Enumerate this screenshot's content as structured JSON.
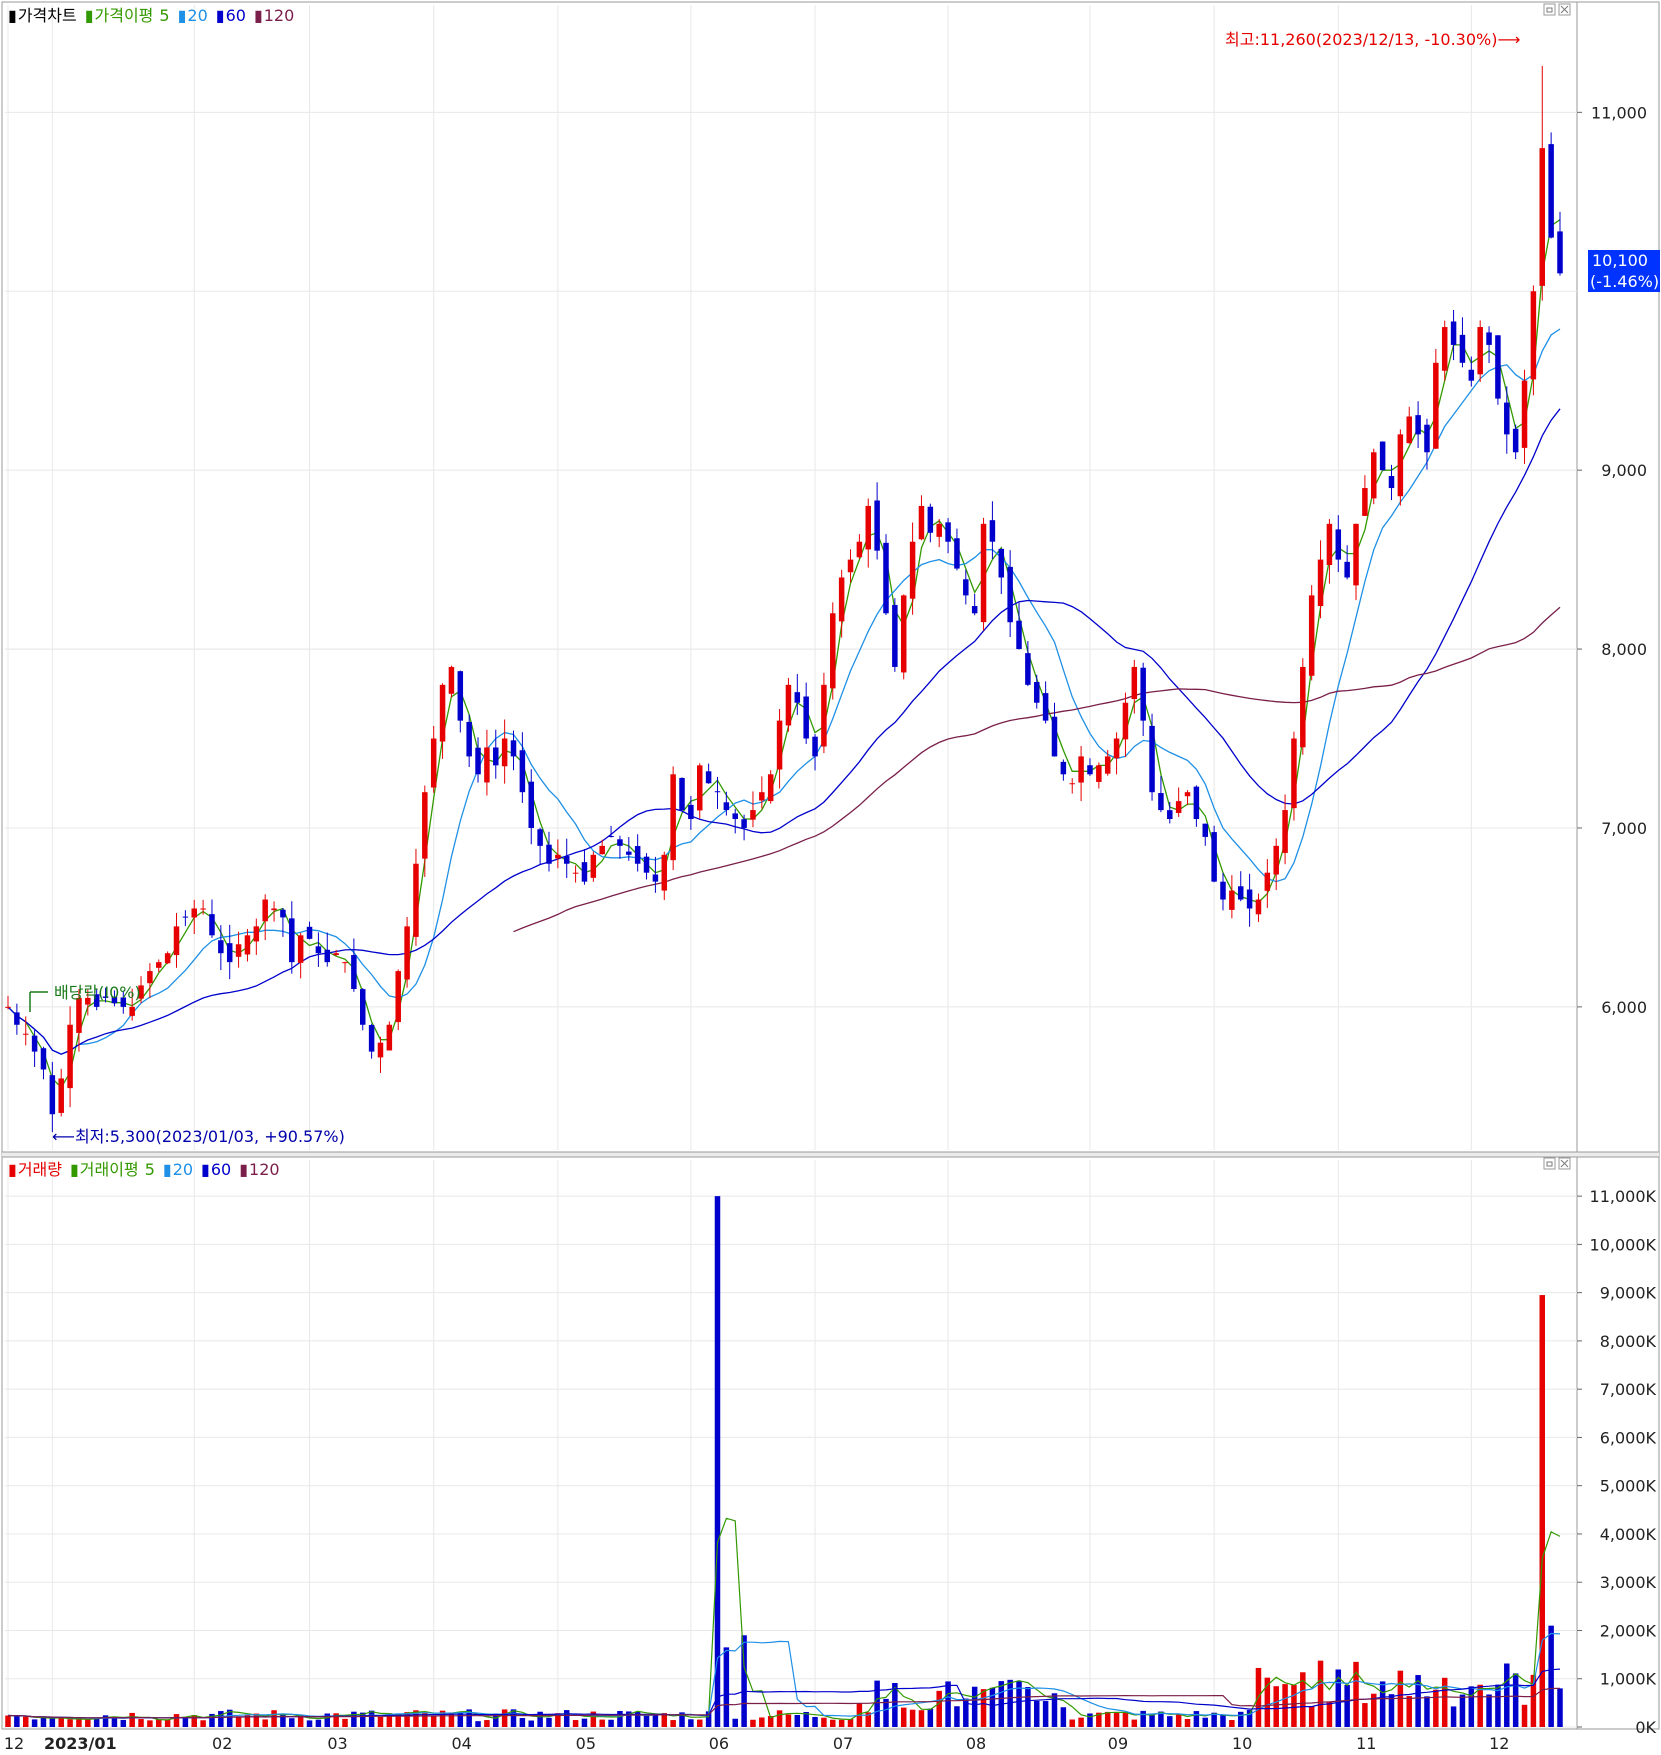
{
  "price_panel": {
    "legend": [
      {
        "label": "가격차트",
        "color": "#000000"
      },
      {
        "label": "가격이평",
        "color": "#339900"
      },
      {
        "label": "5",
        "color": "#339900"
      },
      {
        "label": "20",
        "color": "#1e90e6"
      },
      {
        "label": "60",
        "color": "#0000cc"
      },
      {
        "label": "120",
        "color": "#7a1f4a"
      }
    ],
    "max_annotation": "최고:11,260(2023/12/13, -10.30%)⟶",
    "min_annotation": "⟵최저:5,300(2023/01/03, +90.57%)",
    "dividend_marker": "배당락(I0%)",
    "current_price": "10,100",
    "current_change": "(-1.46%)"
  },
  "volume_panel": {
    "legend": [
      {
        "label": "거래량",
        "color": "#e60000"
      },
      {
        "label": "거래이평",
        "color": "#339900"
      },
      {
        "label": "5",
        "color": "#339900"
      },
      {
        "label": "20",
        "color": "#1e90e6"
      },
      {
        "label": "60",
        "color": "#0000cc"
      },
      {
        "label": "120",
        "color": "#7a1f4a"
      }
    ]
  },
  "chart_data": [
    {
      "type": "candlestick",
      "title": "가격차트",
      "y_ticks": [
        "11,000",
        "9,000",
        "8,000",
        "7,000",
        "6,000"
      ],
      "ylim": [
        5200,
        11600
      ],
      "x_ticks": [
        "12",
        "2023/01",
        "02",
        "03",
        "04",
        "05",
        "06",
        "07",
        "08",
        "09",
        "10",
        "11",
        "12"
      ],
      "grid": true,
      "anchors": {
        "high": 11260,
        "high_date": "2023/12/13",
        "low": 5300,
        "low_date": "2023/01/03",
        "last_close": 10100
      },
      "trend": [
        6000,
        5900,
        5850,
        5750,
        5650,
        5400,
        5600,
        5900,
        6050,
        6050,
        6000,
        6050,
        6020,
        6000,
        6000,
        6120,
        6200,
        6250,
        6300,
        6450,
        6500,
        6550,
        6550,
        6400,
        6300,
        6250,
        6350,
        6400,
        6450,
        6600,
        6550,
        6500,
        6250,
        6400,
        6380,
        6300,
        6250,
        6300,
        6250,
        6100,
        5900,
        5750,
        5800,
        5900,
        6200,
        6450,
        6800,
        7200,
        7500,
        7800,
        7900,
        7600,
        7400,
        7300,
        7450,
        7350,
        7500,
        7400,
        7200,
        7000,
        6900,
        6800,
        6850,
        6800,
        6750,
        6700,
        6850,
        6900,
        6950,
        6900,
        6850,
        6800,
        6750,
        6700,
        6850,
        7300,
        7100,
        7050,
        7350,
        7250,
        7200,
        7100,
        7050,
        7000,
        7100,
        7200,
        7300,
        7600,
        7800,
        7700,
        7500,
        7400,
        7800,
        8200,
        8400,
        8500,
        8600,
        8800,
        8550,
        8200,
        7900,
        8300,
        8600,
        8800,
        8650,
        8700,
        8600,
        8450,
        8300,
        8200,
        8700,
        8600,
        8400,
        8150,
        8000,
        7800,
        7700,
        7600,
        7400,
        7300,
        7250,
        7400,
        7300,
        7350,
        7400,
        7500,
        7700,
        7900,
        7600,
        7200,
        7100,
        7050,
        7150,
        7200,
        7050,
        6950,
        6700,
        6600,
        6650,
        6600,
        6550,
        6600,
        6750,
        6900,
        7100,
        7500,
        7900,
        8300,
        8500,
        8700,
        8500,
        8400,
        8700,
        8900,
        9100,
        9000,
        8900,
        9200,
        9300,
        9200,
        9100,
        9600,
        9800,
        9700,
        9600,
        9500,
        9800,
        9700,
        9400,
        9200,
        9100,
        9500,
        10000,
        10800,
        10300,
        10100
      ],
      "ma_periods": [
        5,
        20,
        60,
        120
      ]
    },
    {
      "type": "bar",
      "title": "거래량",
      "y_ticks": [
        "11,000K",
        "10,000K",
        "9,000K",
        "8,000K",
        "7,000K",
        "6,000K",
        "5,000K",
        "4,000K",
        "3,000K",
        "2,000K",
        "1,000K",
        "0K"
      ],
      "ylim": [
        0,
        11500
      ],
      "unit": "K",
      "volume_spikes": [
        {
          "date": "2023/06",
          "value": 11000
        },
        {
          "date": "2023/12/13",
          "value": 8950
        }
      ],
      "ma_periods": [
        5,
        20,
        60,
        120
      ]
    }
  ]
}
